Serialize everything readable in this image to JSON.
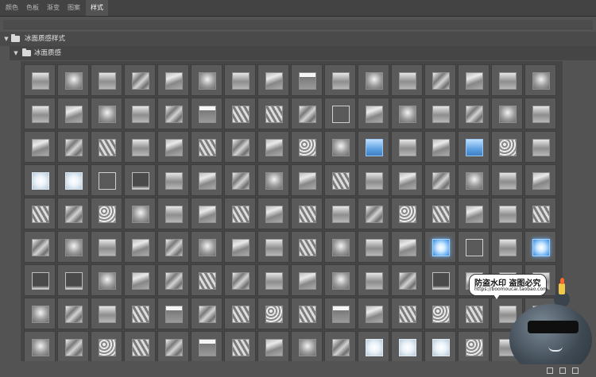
{
  "tabs": [
    {
      "label": "颜色",
      "active": false
    },
    {
      "label": "色板",
      "active": false
    },
    {
      "label": "渐变",
      "active": false
    },
    {
      "label": "图案",
      "active": false
    },
    {
      "label": "样式",
      "active": true
    }
  ],
  "groups": {
    "root": {
      "label": "冰面质感样式",
      "expanded": true
    },
    "sub": {
      "label": "冰面质感",
      "expanded": true
    }
  },
  "icons": {
    "chevron": "chevron-down-icon",
    "folder": "folder-icon"
  },
  "style_grid": {
    "rows": [
      [
        0,
        1,
        0,
        2,
        3,
        1,
        0,
        3,
        4,
        0,
        1,
        0,
        2,
        3,
        0,
        1
      ],
      [
        0,
        3,
        1,
        0,
        2,
        4,
        5,
        5,
        2,
        6,
        3,
        1,
        0,
        2,
        1,
        0
      ],
      [
        3,
        2,
        5,
        0,
        3,
        5,
        2,
        3,
        10,
        1,
        7,
        0,
        3,
        7,
        10,
        0
      ],
      [
        9,
        9,
        6,
        11,
        0,
        3,
        2,
        1,
        3,
        5,
        0,
        3,
        2,
        1,
        0,
        3
      ],
      [
        5,
        2,
        10,
        1,
        0,
        3,
        5,
        3,
        5,
        0,
        2,
        10,
        5,
        3,
        0,
        5
      ],
      [
        2,
        1,
        0,
        3,
        2,
        1,
        3,
        0,
        5,
        1,
        0,
        3,
        8,
        6,
        0,
        8
      ],
      [
        11,
        11,
        1,
        3,
        2,
        5,
        2,
        0,
        3,
        1,
        0,
        2,
        11,
        3,
        0,
        0
      ],
      [
        1,
        2,
        0,
        5,
        4,
        2,
        5,
        10,
        5,
        4,
        3,
        5,
        10,
        5,
        0,
        0
      ],
      [
        1,
        2,
        10,
        5,
        2,
        4,
        5,
        3,
        1,
        2,
        9,
        9,
        9,
        10,
        0,
        0
      ]
    ],
    "colors": {
      "panel": "#535353",
      "tile": "#5a5a5a",
      "ice_blue": "#5d9fe0"
    }
  },
  "watermark": {
    "line1": "防盗水印 盗图必究",
    "line2": "https://boomoucai.taobao.com"
  }
}
